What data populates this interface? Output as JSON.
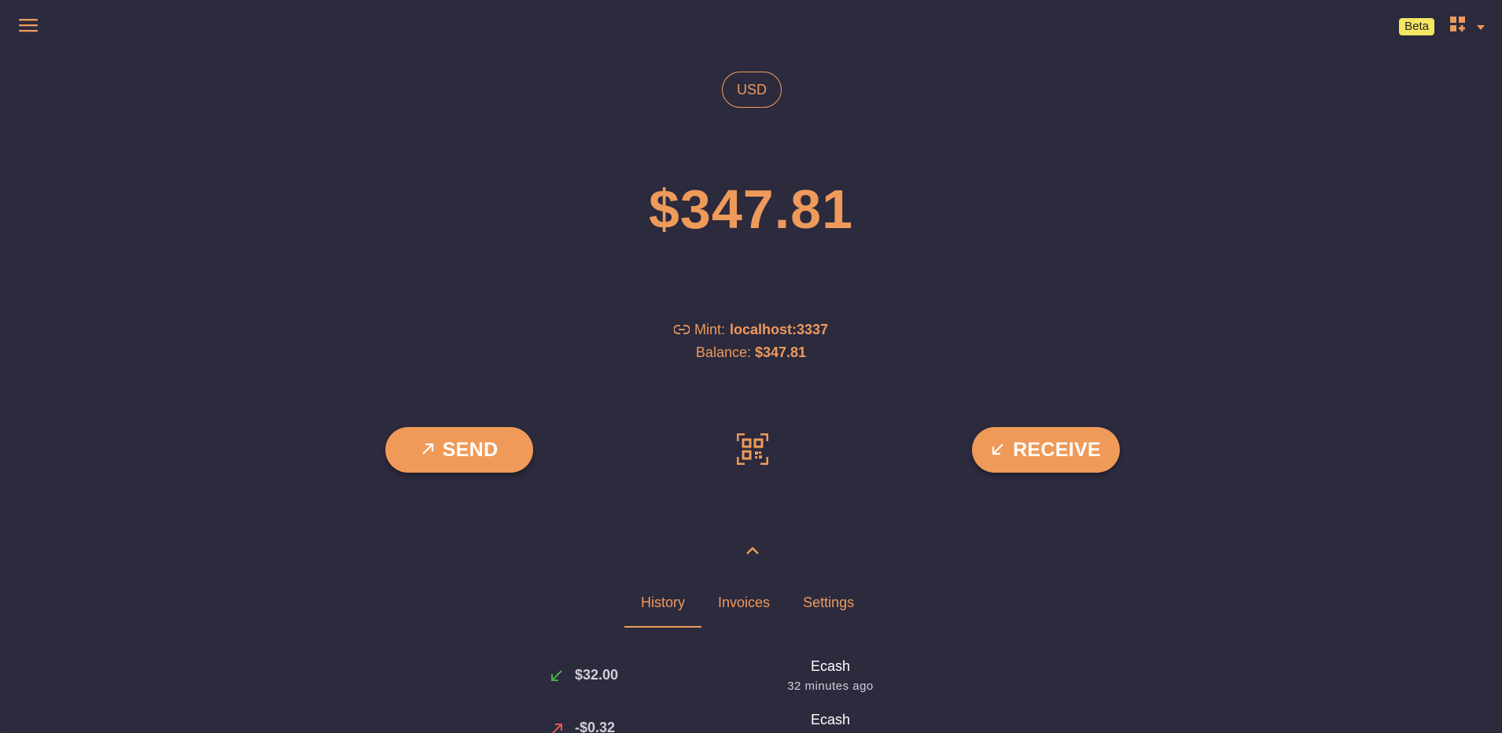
{
  "header": {
    "menu_icon": "hamburger-menu-icon",
    "beta_label": "Beta",
    "grid_icon": "dashboard-grid-icon",
    "dropdown_icon": "caret-down-icon"
  },
  "unit": {
    "label": "USD"
  },
  "balance": {
    "display": "$347.81"
  },
  "mint": {
    "label": "Mint:",
    "value": "localhost:3337",
    "icon": "link-icon"
  },
  "mint_balance": {
    "label": "Balance:",
    "value": "$347.81"
  },
  "actions": {
    "send_label": "SEND",
    "receive_label": "RECEIVE",
    "scan_icon": "qr-scan-icon",
    "expand_icon": "chevron-up-icon"
  },
  "tabs": [
    {
      "label": "History",
      "active": true
    },
    {
      "label": "Invoices",
      "active": false
    },
    {
      "label": "Settings",
      "active": false
    }
  ],
  "history": [
    {
      "direction": "incoming",
      "amount": "$32.00",
      "title": "Ecash",
      "time": "32 minutes ago"
    },
    {
      "direction": "outgoing",
      "amount": "-$0.32",
      "title": "Ecash",
      "time": ""
    }
  ],
  "colors": {
    "background": "#2c2a3d",
    "accent": "#ee9a5b",
    "beta_badge": "#f5e663",
    "incoming": "#4caf50",
    "outgoing": "#e05a4f"
  }
}
